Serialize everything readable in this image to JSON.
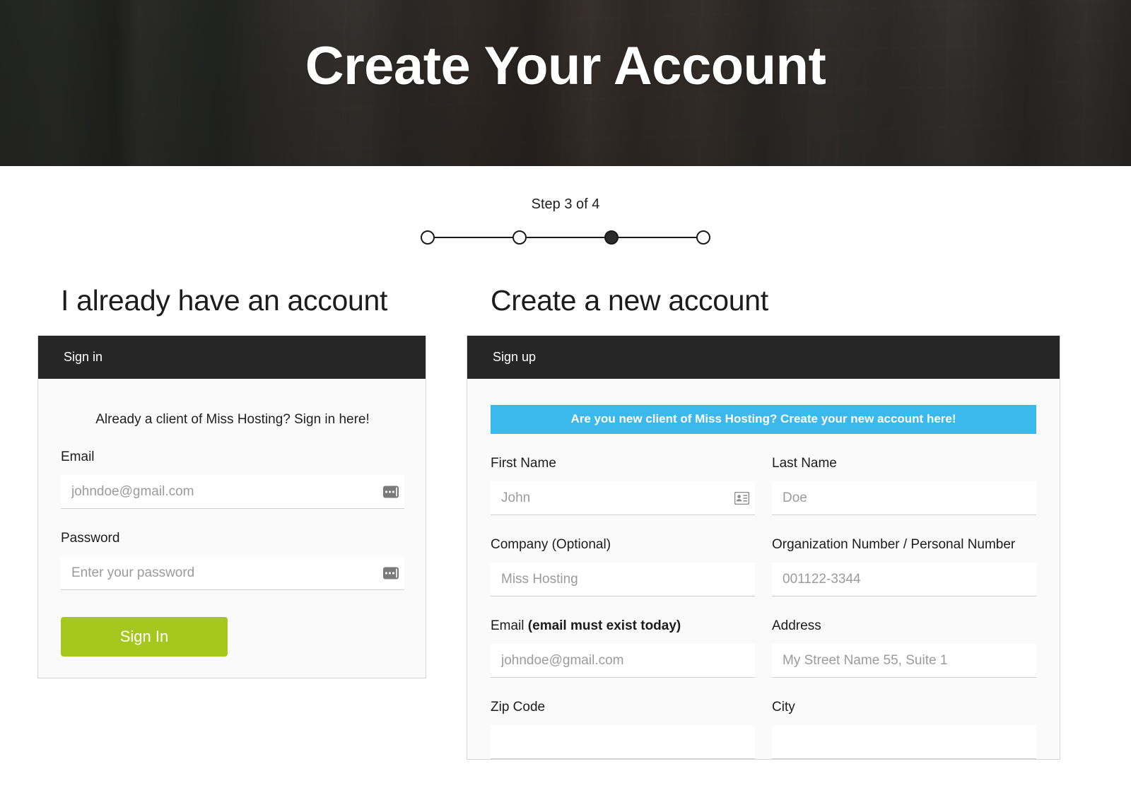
{
  "hero": {
    "title": "Create Your Account"
  },
  "stepper": {
    "label": "Step 3 of 4",
    "total": 4,
    "current": 3,
    "dots": [
      "step-1",
      "step-2",
      "step-3",
      "step-4"
    ]
  },
  "signin": {
    "heading": "I already have an account",
    "panel_title": "Sign in",
    "intro": "Already a client of Miss Hosting? Sign in here!",
    "email_label": "Email",
    "email_placeholder": "johndoe@gmail.com",
    "email_value": "",
    "password_label": "Password",
    "password_placeholder": "Enter your password",
    "password_value": "",
    "submit_label": "Sign In"
  },
  "signup": {
    "heading": "Create a new account",
    "panel_title": "Sign up",
    "banner": "Are you new client of Miss Hosting? Create your new account here!",
    "fields": {
      "first_name_label": "First Name",
      "first_name_placeholder": "John",
      "first_name_value": "",
      "last_name_label": "Last Name",
      "last_name_placeholder": "Doe",
      "last_name_value": "",
      "company_label": "Company (Optional)",
      "company_placeholder": "Miss Hosting",
      "company_value": "",
      "orgnumber_label": "Organization Number / Personal Number",
      "orgnumber_placeholder": "001122-3344",
      "orgnumber_value": "",
      "email_label_normal": "Email ",
      "email_label_bold": "(email must exist today)",
      "email_placeholder": "johndoe@gmail.com",
      "email_value": "",
      "address_label": "Address",
      "address_placeholder": "My Street Name 55, Suite 1",
      "address_value": "",
      "zip_label": "Zip Code",
      "city_label": "City"
    }
  },
  "colors": {
    "panel_header_bg": "#262626",
    "banner_blue": "#3bb9ec",
    "signin_green": "#a4c81e",
    "panel_body_bg": "#fafafa",
    "text_dark": "#1c1c1c"
  },
  "icons": {
    "autofill": "autofill-dots-icon",
    "contact_card": "contact-card-icon"
  }
}
